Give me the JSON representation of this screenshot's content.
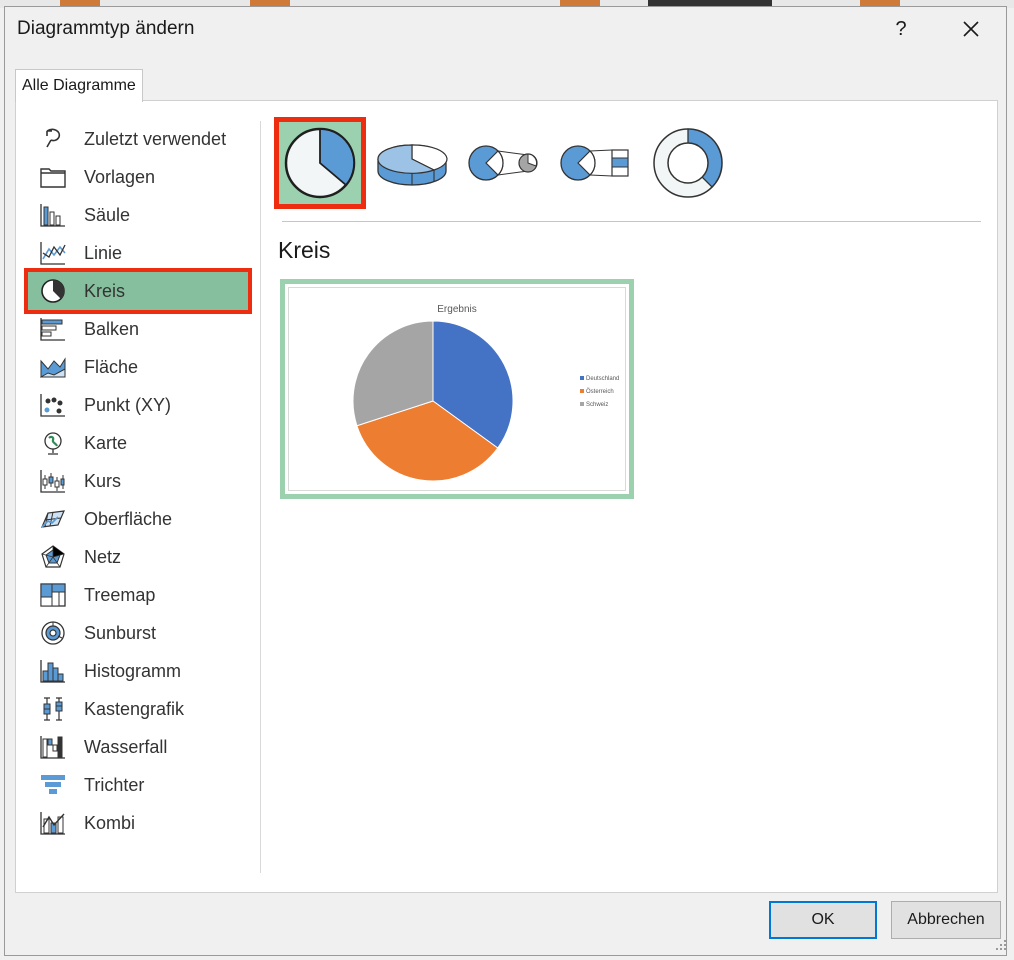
{
  "dialog": {
    "title": "Diagrammtyp ändern",
    "help_label": "?",
    "close_icon": "close-icon"
  },
  "tab": {
    "label": "Alle Diagramme"
  },
  "categories": [
    {
      "label": "Zuletzt verwendet",
      "icon": "recent-icon"
    },
    {
      "label": "Vorlagen",
      "icon": "templates-folder-icon"
    },
    {
      "label": "Säule",
      "icon": "column-chart-icon"
    },
    {
      "label": "Linie",
      "icon": "line-chart-icon"
    },
    {
      "label": "Kreis",
      "icon": "pie-chart-icon",
      "selected": true
    },
    {
      "label": "Balken",
      "icon": "bar-chart-icon"
    },
    {
      "label": "Fläche",
      "icon": "area-chart-icon"
    },
    {
      "label": "Punkt (XY)",
      "icon": "scatter-chart-icon"
    },
    {
      "label": "Karte",
      "icon": "map-globe-icon"
    },
    {
      "label": "Kurs",
      "icon": "stock-chart-icon"
    },
    {
      "label": "Oberfläche",
      "icon": "surface-chart-icon"
    },
    {
      "label": "Netz",
      "icon": "radar-chart-icon"
    },
    {
      "label": "Treemap",
      "icon": "treemap-icon"
    },
    {
      "label": "Sunburst",
      "icon": "sunburst-icon"
    },
    {
      "label": "Histogramm",
      "icon": "histogram-icon"
    },
    {
      "label": "Kastengrafik",
      "icon": "box-whisker-icon"
    },
    {
      "label": "Wasserfall",
      "icon": "waterfall-icon"
    },
    {
      "label": "Trichter",
      "icon": "funnel-icon"
    },
    {
      "label": "Kombi",
      "icon": "combo-chart-icon"
    }
  ],
  "subtypes": [
    {
      "icon": "pie-icon",
      "selected": true
    },
    {
      "icon": "pie-3d-icon"
    },
    {
      "icon": "pie-of-pie-icon"
    },
    {
      "icon": "bar-of-pie-icon"
    },
    {
      "icon": "doughnut-icon"
    }
  ],
  "selected_type_title": "Kreis",
  "colors": {
    "selection_fill": "#86bf9d",
    "selection_border": "#ee2c10",
    "preview_border": "#9bd1ae",
    "icon_blue": "#5b9bd5"
  },
  "chart_data": {
    "type": "pie",
    "title": "Ergebnis",
    "categories": [
      "Deutschland",
      "Österreich",
      "Schweiz"
    ],
    "values": [
      35,
      35,
      30
    ],
    "colors": [
      "#4472c4",
      "#ed7d31",
      "#a5a5a5"
    ],
    "legend_position": "right"
  },
  "buttons": {
    "ok": "OK",
    "cancel": "Abbrechen"
  }
}
